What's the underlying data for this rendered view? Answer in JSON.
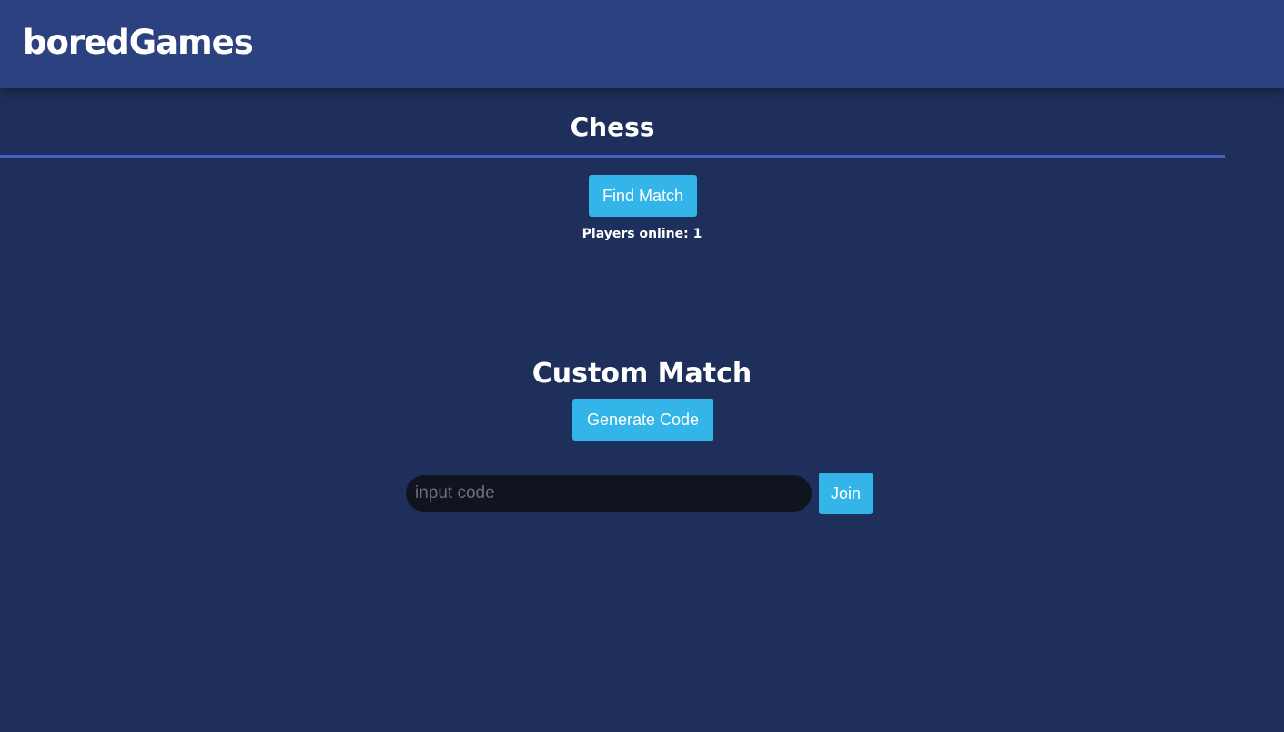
{
  "header": {
    "logo": "boredGames"
  },
  "game": {
    "title": "Chess",
    "find_match_label": "Find Match",
    "players_online": "Players online: 1"
  },
  "custom": {
    "title": "Custom Match",
    "generate_label": "Generate Code",
    "input_placeholder": "input code",
    "input_value": "",
    "join_label": "Join"
  },
  "colors": {
    "header_bg": "#2c4180",
    "page_bg": "#1f2f5b",
    "accent_divider": "#4660c3",
    "button_bg": "#33b5e9",
    "input_bg": "#10141f"
  }
}
